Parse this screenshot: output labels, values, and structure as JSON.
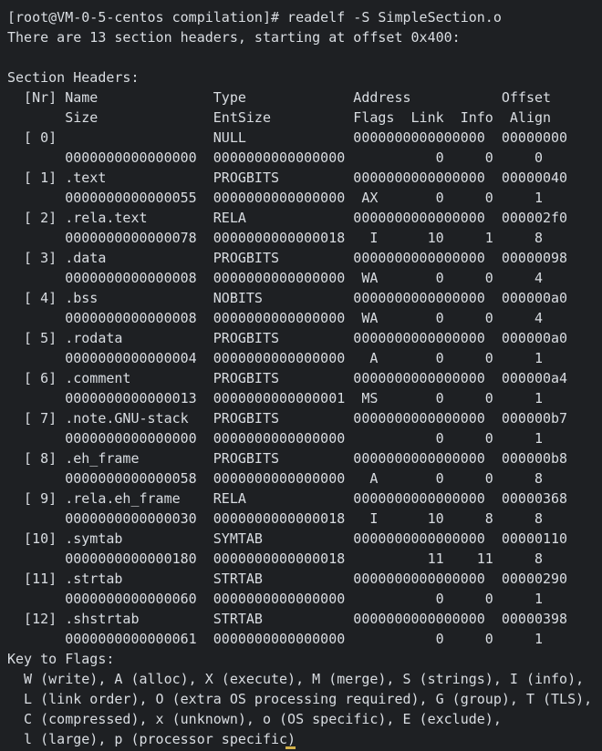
{
  "terminal": {
    "lines": [
      "[root@VM-0-5-centos compilation]# readelf -S SimpleSection.o",
      "There are 13 section headers, starting at offset 0x400:",
      "",
      "Section Headers:",
      "  [Nr] Name              Type             Address           Offset",
      "       Size              EntSize          Flags  Link  Info  Align",
      "  [ 0]                   NULL             0000000000000000  00000000",
      "       0000000000000000  0000000000000000           0     0     0",
      "  [ 1] .text             PROGBITS         0000000000000000  00000040",
      "       0000000000000055  0000000000000000  AX       0     0     1",
      "  [ 2] .rela.text        RELA             0000000000000000  000002f0",
      "       0000000000000078  0000000000000018   I      10     1     8",
      "  [ 3] .data             PROGBITS         0000000000000000  00000098",
      "       0000000000000008  0000000000000000  WA       0     0     4",
      "  [ 4] .bss              NOBITS           0000000000000000  000000a0",
      "       0000000000000008  0000000000000000  WA       0     0     4",
      "  [ 5] .rodata           PROGBITS         0000000000000000  000000a0",
      "       0000000000000004  0000000000000000   A       0     0     1",
      "  [ 6] .comment          PROGBITS         0000000000000000  000000a4",
      "       0000000000000013  0000000000000001  MS       0     0     1",
      "  [ 7] .note.GNU-stack   PROGBITS         0000000000000000  000000b7",
      "       0000000000000000  0000000000000000           0     0     1",
      "  [ 8] .eh_frame         PROGBITS         0000000000000000  000000b8",
      "       0000000000000058  0000000000000000   A       0     0     8",
      "  [ 9] .rela.eh_frame    RELA             0000000000000000  00000368",
      "       0000000000000030  0000000000000018   I      10     8     8",
      "  [10] .symtab           SYMTAB           0000000000000000  00000110",
      "       0000000000000180  0000000000000018          11    11     8",
      "  [11] .strtab           STRTAB           0000000000000000  00000290",
      "       0000000000000060  0000000000000000           0     0     1",
      "  [12] .shstrtab         STRTAB           0000000000000000  00000398",
      "       0000000000000061  0000000000000000           0     0     1",
      "Key to Flags:",
      "  W (write), A (alloc), X (execute), M (merge), S (strings), I (info),",
      "  L (link order), O (extra OS processing required), G (group), T (TLS),",
      "  C (compressed), x (unknown), o (OS specific), E (exclude),",
      "  l (large), p (processor specific)"
    ]
  },
  "colors": {
    "background": "#1e2023",
    "text": "#d9dde2",
    "cursor": "#d4b24a"
  }
}
